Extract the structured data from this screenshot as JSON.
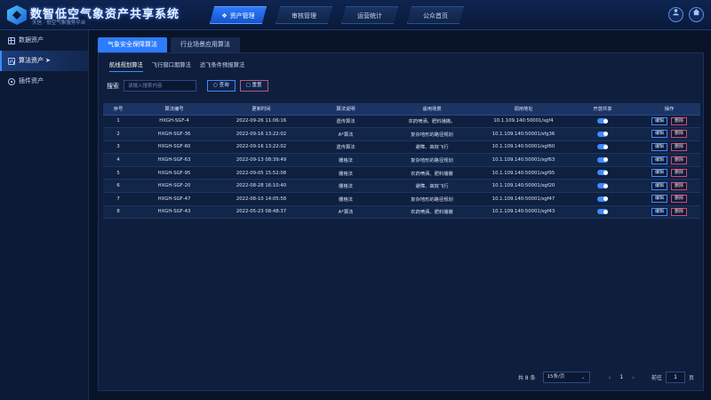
{
  "app": {
    "title": "数智低空气象资产共享系统",
    "subtitle": "天信 · 低空气象服务平台"
  },
  "top_nav": {
    "items": [
      {
        "label": "资产管理",
        "icon": "asset-icon",
        "active": true
      },
      {
        "label": "审核管理",
        "active": false
      },
      {
        "label": "运营统计",
        "active": false
      },
      {
        "label": "公众首页",
        "active": false
      }
    ]
  },
  "header_actions": {
    "user_icon": "user-icon",
    "home_icon": "home-icon"
  },
  "sidebar": {
    "items": [
      {
        "label": "数据资产",
        "icon": "grid-icon",
        "active": false
      },
      {
        "label": "算法资产",
        "icon": "chart-icon",
        "active": true
      },
      {
        "label": "插件资产",
        "icon": "plugin-icon",
        "active": false
      }
    ]
  },
  "main_tabs": [
    {
      "label": "气象安全保障算法",
      "active": true
    },
    {
      "label": "行业场景应用算法",
      "active": false
    }
  ],
  "sub_tabs": [
    {
      "label": "航线规划算法",
      "active": true
    },
    {
      "label": "飞行窗口期算法",
      "active": false
    },
    {
      "label": "适飞条件预报算法",
      "active": false
    }
  ],
  "search": {
    "label": "搜索",
    "placeholder": "请输入搜索内容",
    "query_label": "查询",
    "reset_label": "重置"
  },
  "table": {
    "columns": [
      "序号",
      "算法编号",
      "更新时间",
      "算法说明",
      "适用场景",
      "调用地址",
      "开放共享",
      "操作"
    ],
    "edit_label": "编辑",
    "delete_label": "删除",
    "rows": [
      {
        "no": "1",
        "code": "HXGH-SGF-4",
        "time": "2022-09-26 11:06:16",
        "desc": "遗传算法",
        "scene": "农药喷洒、肥料播撒。",
        "url": "10.1.109.140:50001/sgf4",
        "shared": true
      },
      {
        "no": "2",
        "code": "HXGH-SGF-36",
        "time": "2022-09-16 13:22:02",
        "desc": "A*算法",
        "scene": "复杂地形的路径规划",
        "url": "10.1.109.140:50001/sfg36",
        "shared": true
      },
      {
        "no": "3",
        "code": "HXGH-SGF-60",
        "time": "2022-09-16 13:22:02",
        "desc": "遗传算法",
        "scene": "避障、高效飞行",
        "url": "10.1.109.140:50001/sgf60",
        "shared": true
      },
      {
        "no": "4",
        "code": "HXGH-SGF-63",
        "time": "2022-09-13 08:39:49",
        "desc": "栅格法",
        "scene": "复杂地形的路径规划",
        "url": "10.1.109.140:50001/sgf63",
        "shared": true
      },
      {
        "no": "5",
        "code": "HXGH-SGF-95",
        "time": "2022-09-05 15:52:08",
        "desc": "栅格法",
        "scene": "农药喷洒、肥料播撒",
        "url": "10.1.109.140:50001/sgf95",
        "shared": true
      },
      {
        "no": "6",
        "code": "HXGH-SGF-20",
        "time": "2022-08-28 16:10:40",
        "desc": "栅格法",
        "scene": "避障、高效飞行",
        "url": "10.1.109.140:50001/sgf20",
        "shared": true
      },
      {
        "no": "7",
        "code": "HXGH-SGF-47",
        "time": "2022-08-10 14:05:58",
        "desc": "栅格法",
        "scene": "复杂地形的路径规划",
        "url": "10.1.109.140:50001/sgf47",
        "shared": true
      },
      {
        "no": "8",
        "code": "HXGH-SGF-43",
        "time": "2022-05-23 08:48:37",
        "desc": "A*算法",
        "scene": "农药喷洒、肥料播撒",
        "url": "10.1.109.140:50001/sgf43",
        "shared": true
      }
    ]
  },
  "pagination": {
    "total": "共 8 条",
    "page_size": "15条/页",
    "prev": "‹",
    "current": "1",
    "next": "›",
    "goto_label": "前往",
    "goto_value": "1",
    "goto_suffix": "页"
  },
  "colors": {
    "accent": "#2d7bff",
    "background": "#0a1428",
    "danger": "#d04a6e"
  }
}
